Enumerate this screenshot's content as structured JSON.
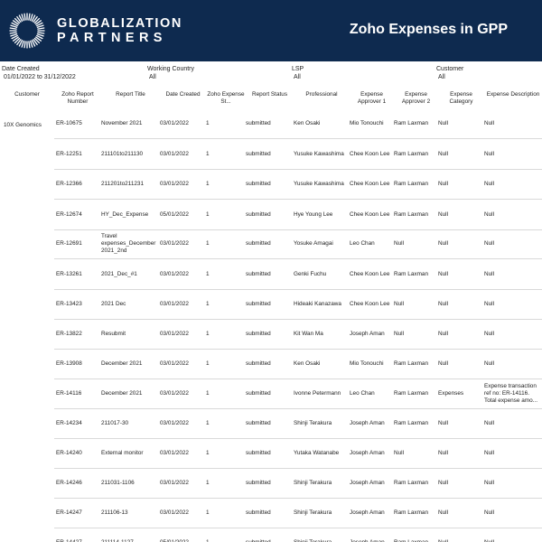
{
  "header": {
    "brand_line1": "GLOBALIZATION",
    "brand_line2": "PARTNERS",
    "title": "Zoho Expenses in GPP"
  },
  "filters": [
    {
      "label": "Date Created",
      "value": "01/01/2022 to 31/12/2022"
    },
    {
      "label": "Working Country",
      "value": "All"
    },
    {
      "label": "LSP",
      "value": "All"
    },
    {
      "label": "Customer",
      "value": "All"
    }
  ],
  "table": {
    "columns": [
      "Customer",
      "Zoho Report Number",
      "Report Title",
      "Date Created",
      "Zoho Expense St...",
      "Report Status",
      "Professional",
      "Expense Approver 1",
      "Expense Approver 2",
      "Expense Category",
      "Expense Description"
    ],
    "customer": "10X Genomics",
    "rows": [
      {
        "num": "ER-10675",
        "title": "November 2021",
        "date": "03/01/2022",
        "zst": "1",
        "status": "submitted",
        "prof": "Ken Osaki",
        "a1": "Mio Tonouchi",
        "a2": "Ram Laxman",
        "cat": "Null",
        "desc": "Null"
      },
      {
        "num": "ER-12251",
        "title": "211101to211130",
        "date": "03/01/2022",
        "zst": "1",
        "status": "submitted",
        "prof": "Yusuke Kawashima",
        "a1": "Chee Koon Lee",
        "a2": "Ram Laxman",
        "cat": "Null",
        "desc": "Null"
      },
      {
        "num": "ER-12366",
        "title": "211201to211231",
        "date": "03/01/2022",
        "zst": "1",
        "status": "submitted",
        "prof": "Yusuke Kawashima",
        "a1": "Chee Koon Lee",
        "a2": "Ram Laxman",
        "cat": "Null",
        "desc": "Null"
      },
      {
        "num": "ER-12674",
        "title": "HY_Dec_Expense",
        "date": "05/01/2022",
        "zst": "1",
        "status": "submitted",
        "prof": "Hye Young Lee",
        "a1": "Chee Koon Lee",
        "a2": "Ram Laxman",
        "cat": "Null",
        "desc": "Null"
      },
      {
        "num": "ER-12691",
        "title": "Travel expenses_December 2021_2nd",
        "date": "03/01/2022",
        "zst": "1",
        "status": "submitted",
        "prof": "Yosuke Amagai",
        "a1": "Leo Chan",
        "a2": "Null",
        "cat": "Null",
        "desc": "Null"
      },
      {
        "num": "ER-13261",
        "title": "2021_Dec_#1",
        "date": "03/01/2022",
        "zst": "1",
        "status": "submitted",
        "prof": "Genki Fuchu",
        "a1": "Chee Koon Lee",
        "a2": "Ram Laxman",
        "cat": "Null",
        "desc": "Null"
      },
      {
        "num": "ER-13423",
        "title": "2021 Dec",
        "date": "03/01/2022",
        "zst": "1",
        "status": "submitted",
        "prof": "Hideaki Kanazawa",
        "a1": "Chee Koon Lee",
        "a2": "Null",
        "cat": "Null",
        "desc": "Null"
      },
      {
        "num": "ER-13822",
        "title": "Resubmit",
        "date": "03/01/2022",
        "zst": "1",
        "status": "submitted",
        "prof": "Kit Wan Ma",
        "a1": "Joseph Aman",
        "a2": "Null",
        "cat": "Null",
        "desc": "Null"
      },
      {
        "num": "ER-13908",
        "title": "December 2021",
        "date": "03/01/2022",
        "zst": "1",
        "status": "submitted",
        "prof": "Ken Osaki",
        "a1": "Mio Tonouchi",
        "a2": "Ram Laxman",
        "cat": "Null",
        "desc": "Null"
      },
      {
        "num": "ER-14116",
        "title": "December 2021",
        "date": "03/01/2022",
        "zst": "1",
        "status": "submitted",
        "prof": "Ivonne Petermann",
        "a1": "Leo Chan",
        "a2": "Ram Laxman",
        "cat": "Expenses",
        "desc": "Expense transaction ref no: ER-14116. Total expense amo..."
      },
      {
        "num": "ER-14234",
        "title": "211017-30",
        "date": "03/01/2022",
        "zst": "1",
        "status": "submitted",
        "prof": "Shinji Terakura",
        "a1": "Joseph Aman",
        "a2": "Ram Laxman",
        "cat": "Null",
        "desc": "Null"
      },
      {
        "num": "ER-14240",
        "title": "External monitor",
        "date": "03/01/2022",
        "zst": "1",
        "status": "submitted",
        "prof": "Yutaka Watanabe",
        "a1": "Joseph Aman",
        "a2": "Null",
        "cat": "Null",
        "desc": "Null"
      },
      {
        "num": "ER-14246",
        "title": "211031-1106",
        "date": "03/01/2022",
        "zst": "1",
        "status": "submitted",
        "prof": "Shinji Terakura",
        "a1": "Joseph Aman",
        "a2": "Ram Laxman",
        "cat": "Null",
        "desc": "Null"
      },
      {
        "num": "ER-14247",
        "title": "211106-13",
        "date": "03/01/2022",
        "zst": "1",
        "status": "submitted",
        "prof": "Shinji Terakura",
        "a1": "Joseph Aman",
        "a2": "Ram Laxman",
        "cat": "Null",
        "desc": "Null"
      },
      {
        "num": "ER-14427",
        "title": "211114-1127",
        "date": "05/01/2022",
        "zst": "1",
        "status": "submitted",
        "prof": "Shinji Terakura",
        "a1": "Joseph Aman",
        "a2": "Ram Laxman",
        "cat": "Null",
        "desc": "Null"
      }
    ]
  }
}
